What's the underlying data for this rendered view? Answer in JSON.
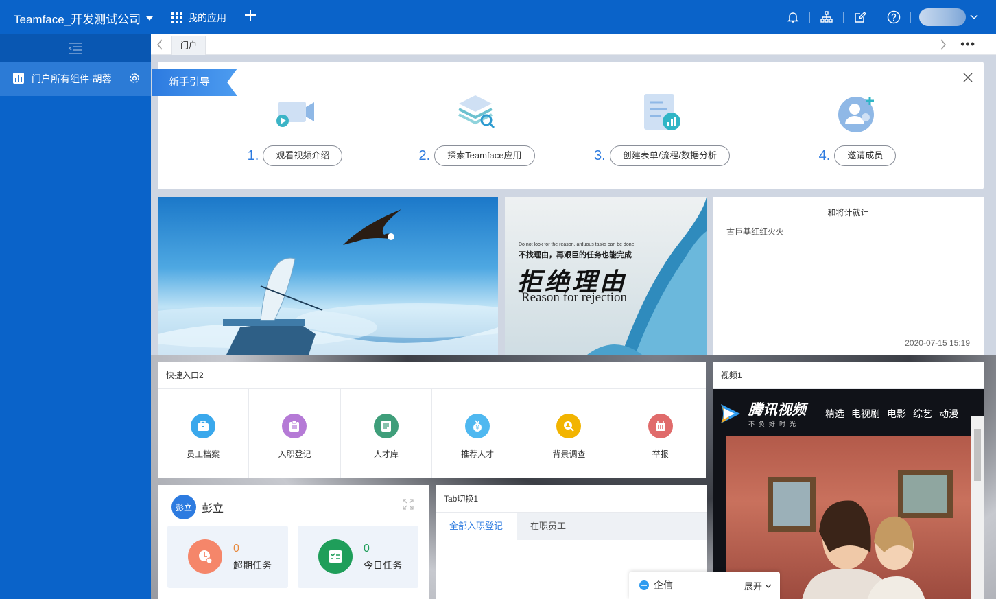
{
  "header": {
    "company": "Teamface_开发测试公司",
    "apps_label": "我的应用"
  },
  "sidebar": {
    "items": [
      {
        "label": "门户所有组件-胡蓉",
        "icon": "bar-chart-icon"
      }
    ]
  },
  "tabs": {
    "items": [
      {
        "label": "门户"
      }
    ],
    "more": "•••"
  },
  "guide": {
    "title": "新手引导",
    "steps": [
      {
        "num": "1.",
        "label": "观看视频介绍"
      },
      {
        "num": "2.",
        "label": "探索Teamface应用"
      },
      {
        "num": "3.",
        "label": "创建表单/流程/数据分析"
      },
      {
        "num": "4.",
        "label": "邀请成员"
      }
    ]
  },
  "banner2": {
    "small": "Do not look for the reason, arduous tasks can be done",
    "cn_line": "不找理由，再艰巨的任务也能完成",
    "big": "拒绝理由",
    "en": "Reason for rejection"
  },
  "note": {
    "title": "和将计就计",
    "body": "古巨基红红火火",
    "date": "2020-07-15 15:19"
  },
  "quick": {
    "title": "快捷入口2",
    "items": [
      {
        "label": "员工档案",
        "color": "#3aa8ec",
        "icon": "briefcase-icon"
      },
      {
        "label": "入职登记",
        "color": "#b57ad6",
        "icon": "clipboard-icon"
      },
      {
        "label": "人才库",
        "color": "#3f9e7a",
        "icon": "document-icon"
      },
      {
        "label": "推荐人才",
        "color": "#4fb8f0",
        "icon": "recommend-icon"
      },
      {
        "label": "背景调查",
        "color": "#f2b400",
        "icon": "search-person-icon"
      },
      {
        "label": "举报",
        "color": "#e06b6b",
        "icon": "calendar-icon"
      }
    ]
  },
  "video": {
    "title": "视频1",
    "brand": "腾讯视频",
    "slogan": "不负好时光",
    "nav": [
      "精选",
      "电视剧",
      "电影",
      "综艺",
      "动漫"
    ]
  },
  "profile": {
    "avatar_text": "彭立",
    "name": "彭立",
    "stats": [
      {
        "value": "0",
        "label": "超期任务",
        "color": "#f5866a",
        "value_color": "#e8893d"
      },
      {
        "value": "0",
        "label": "今日任务",
        "color": "#1f9e5a",
        "value_color": "#1f9e5a"
      }
    ]
  },
  "tabcard": {
    "title": "Tab切换1",
    "tabs": [
      "全部入职登记",
      "在职员工"
    ]
  },
  "qixin": {
    "label": "企信",
    "open": "展开"
  },
  "colors": {
    "brand": "#0a63c9",
    "accent": "#2d7be0"
  }
}
